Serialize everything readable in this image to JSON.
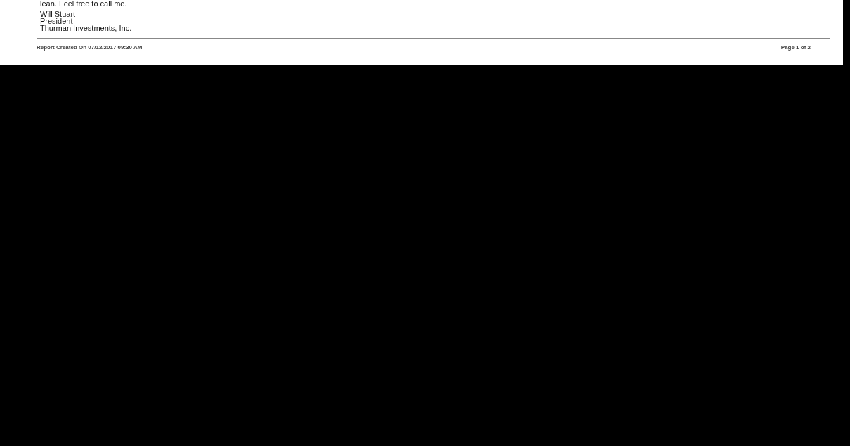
{
  "letter": {
    "lines": [
      "lean. Feel free to call me."
    ],
    "signature": [
      "Will Stuart",
      "President",
      "Thurman Investments, Inc."
    ]
  },
  "footer": {
    "created": "Report Created On 07/12/2017 09:30 AM",
    "page": "Page 1 of 2"
  }
}
